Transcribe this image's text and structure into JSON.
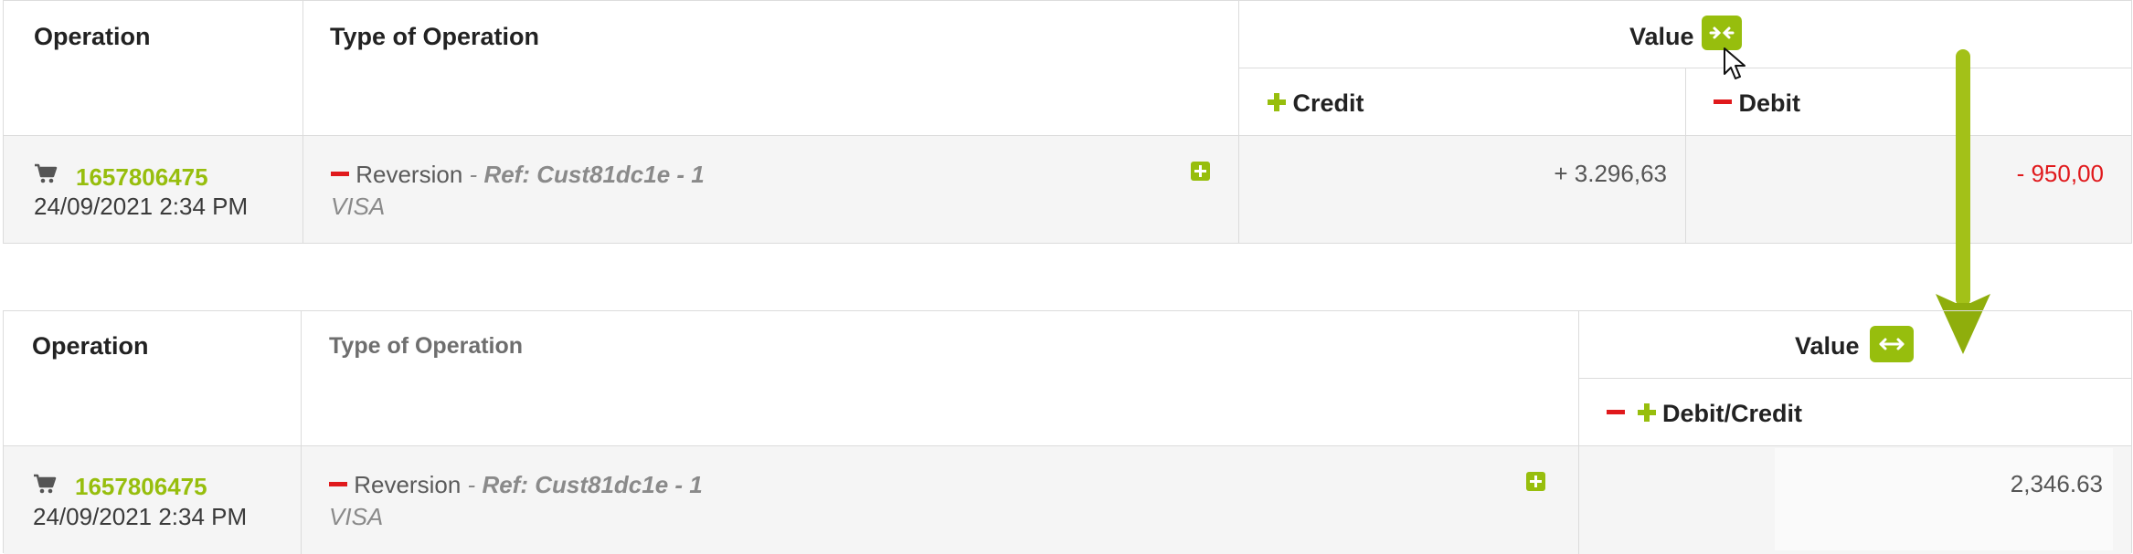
{
  "table_before": {
    "headers": {
      "operation": "Operation",
      "type": "Type of Operation",
      "value": "Value",
      "credit": "Credit",
      "debit": "Debit"
    },
    "row": {
      "operation_id": "1657806475",
      "date": "24/09/2021 2:34 PM",
      "type_label": "Reversion",
      "type_dash": "-",
      "ref": "Ref: Cust81dc1e - 1",
      "card": "VISA",
      "credit_value": "+ 3.296,63",
      "debit_value": "- 950,00"
    }
  },
  "table_after": {
    "headers": {
      "operation": "Operation",
      "type": "Type of Operation",
      "value": "Value",
      "debit_credit": "Debit/Credit"
    },
    "row": {
      "operation_id": "1657806475",
      "date": "24/09/2021 2:34 PM",
      "type_label": "Reversion",
      "type_dash": "-",
      "ref": "Ref: Cust81dc1e - 1",
      "card": "VISA",
      "value": "2,346.63"
    }
  },
  "colors": {
    "accent_green": "#97be0d",
    "debit_red": "#e0191c",
    "border": "#dcdcdc",
    "row_bg": "#f5f5f5"
  },
  "icons": {
    "collapse": "collapse-columns-icon",
    "expand": "expand-columns-icon",
    "cart": "cart-icon",
    "add": "plus-square-icon",
    "cursor": "mouse-pointer-icon",
    "arrow": "down-arrow-icon"
  }
}
